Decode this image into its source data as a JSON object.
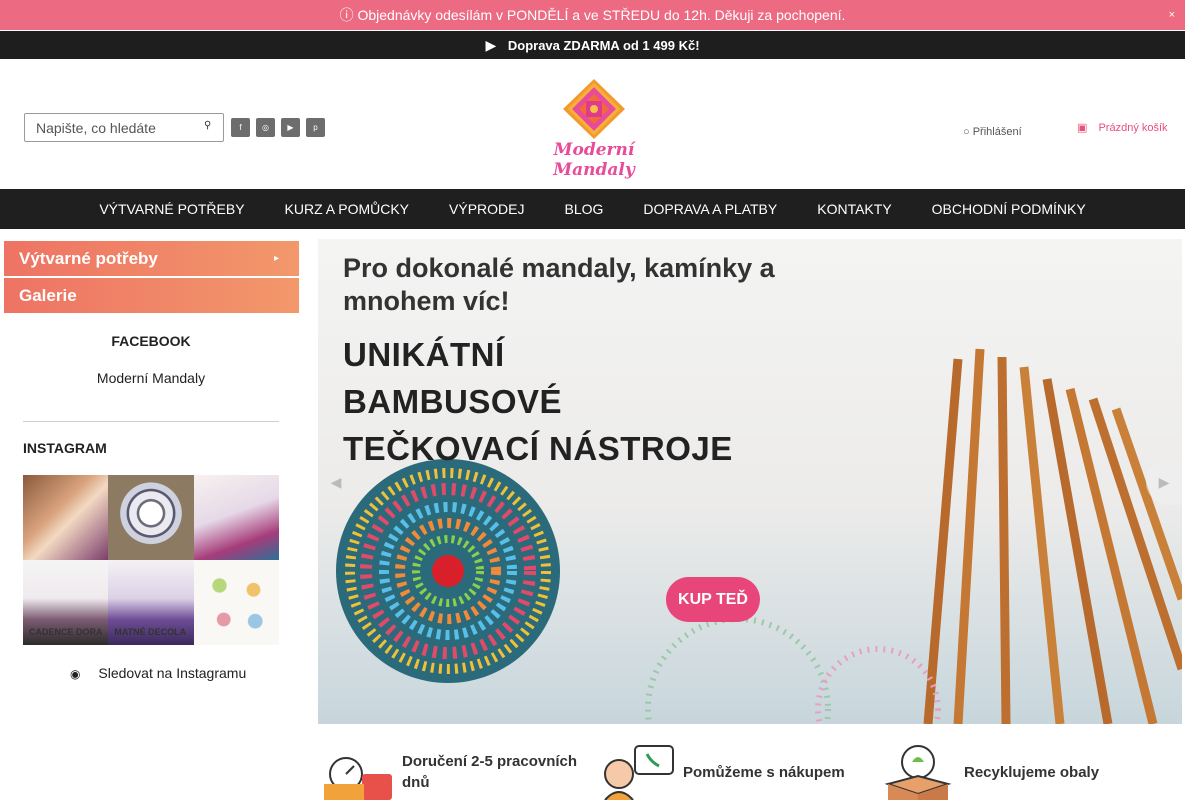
{
  "announcement": {
    "text": "Objednávky odesílám v PONDĚLÍ a ve STŘEDU do 12h. Děkuji za pochopení.",
    "close": "×"
  },
  "shipping": {
    "text": "Doprava ZDARMA od 1 499 Kč!"
  },
  "search": {
    "placeholder": "Napište, co hledáte"
  },
  "logo": {
    "text": "Moderní Mandaly"
  },
  "account": {
    "login": "Přihlášení",
    "cart": "Prázdný košík"
  },
  "nav": [
    {
      "label": "VÝTVARNÉ POTŘEBY"
    },
    {
      "label": "KURZ A POMŮCKY"
    },
    {
      "label": "VÝPRODEJ"
    },
    {
      "label": "BLOG"
    },
    {
      "label": "DOPRAVA A PLATBY"
    },
    {
      "label": "KONTAKTY"
    },
    {
      "label": "OBCHODNÍ PODMÍNKY"
    }
  ],
  "sidebar": {
    "categories": [
      {
        "label": "Výtvarné potřeby"
      },
      {
        "label": "Galerie"
      }
    ],
    "facebook": {
      "title": "FACEBOOK",
      "link": "Moderní Mandaly"
    },
    "instagram": {
      "title": "INSTAGRAM",
      "follow": "Sledovat na Instagramu",
      "captions": [
        "",
        "",
        "",
        "CADENCE DORA",
        "MATNÉ DECOLA",
        ""
      ]
    }
  },
  "banner": {
    "headline": "Pro dokonalé mandaly, kamínky a mnohem víc!",
    "headline_line1": "Pro dokonalé mandaly, kamínky a",
    "headline_line2": "mnohem víc!",
    "title_line1": "UNIKÁTNÍ",
    "title_line2": "BAMBUSOVÉ",
    "title_line3": "TEČKOVACÍ NÁSTROJE",
    "cta": "KUP TEĎ"
  },
  "features": [
    {
      "label": "Doručení 2-5 pracovních dnů",
      "icon": "delivery-truck-icon"
    },
    {
      "label": "Pomůžeme s nákupem",
      "icon": "support-agent-icon"
    },
    {
      "label": "Recyklujeme obaly",
      "icon": "recycle-box-icon"
    }
  ],
  "colors": {
    "announcement": "#ec6a82",
    "dark": "#1e1e1e",
    "accent": "#e8467a",
    "category": "#ee7364"
  }
}
